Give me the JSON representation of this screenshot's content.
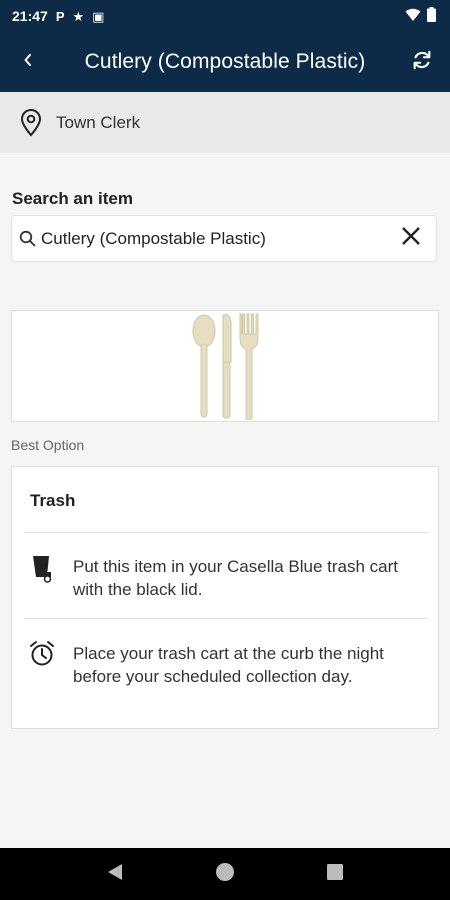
{
  "status_bar": {
    "time": "21:47",
    "left_icons": [
      "P",
      "★",
      "▣"
    ],
    "right_icons": [
      "wifi-icon",
      "battery-icon"
    ]
  },
  "app_bar": {
    "title": "Cutlery (Compostable Plastic)",
    "back_icon": "chevron-left-icon",
    "refresh_icon": "refresh-icon"
  },
  "location": {
    "label": "Town Clerk",
    "icon": "location-pin-icon"
  },
  "search": {
    "heading": "Search an item",
    "value": "Cutlery (Compostable Plastic)",
    "icon": "search-icon",
    "clear_icon": "close-icon"
  },
  "item_image": {
    "icon": "cutlery-image"
  },
  "best_option": {
    "label": "Best Option",
    "title": "Trash",
    "instructions": [
      {
        "icon": "trash-cart-icon",
        "text": "Put this item in your Casella Blue trash cart with the black lid."
      },
      {
        "icon": "alarm-clock-icon",
        "text": "Place your trash cart at the curb the night before your scheduled collection day."
      }
    ]
  },
  "nav_bar": {
    "buttons": [
      "back-triangle-icon",
      "home-circle-icon",
      "recents-square-icon"
    ]
  },
  "colors": {
    "header": "#0d2a47",
    "location_bg": "#e9e9e9",
    "page_bg": "#f5f5f5",
    "nav_bg": "#000000"
  }
}
